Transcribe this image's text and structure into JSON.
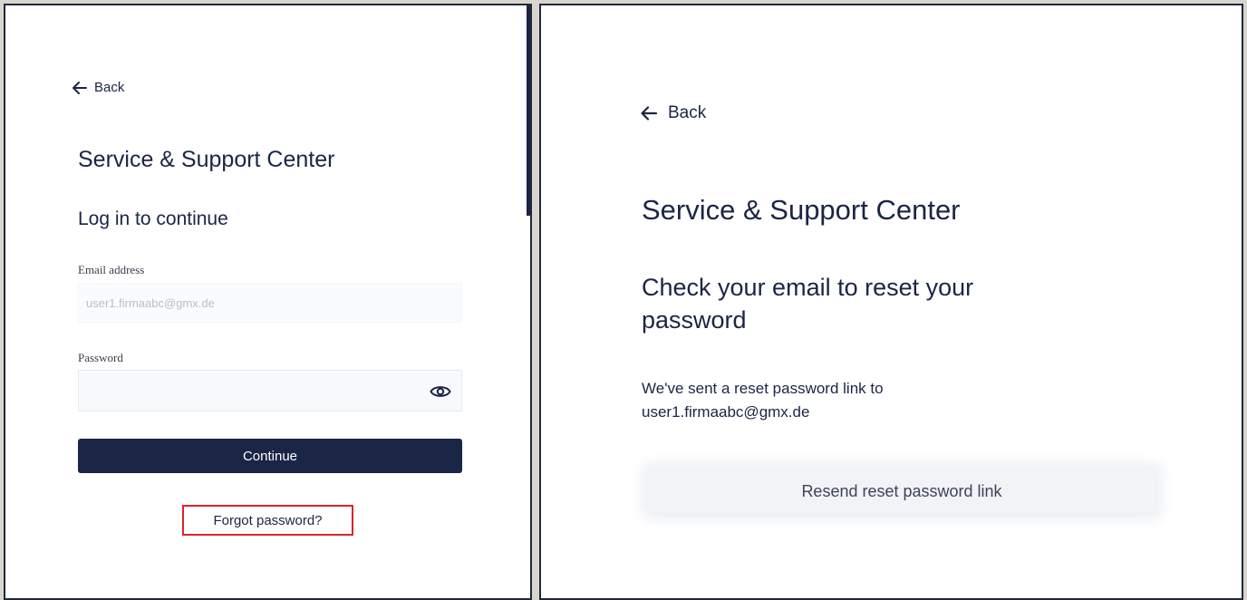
{
  "login_panel": {
    "back_label": "Back",
    "app_title": "Service & Support Center",
    "heading": "Log in to continue",
    "email": {
      "label": "Email address",
      "value": "user1.firmaabc@gmx.de"
    },
    "password": {
      "label": "Password",
      "value": ""
    },
    "continue_label": "Continue",
    "forgot_label": "Forgot password?"
  },
  "reset_panel": {
    "back_label": "Back",
    "app_title": "Service & Support Center",
    "heading": "Check your email to reset your password",
    "message_line1": "We've sent a reset password link to",
    "message_email": "user1.firmaabc@gmx.de",
    "resend_label": "Resend reset password link"
  },
  "colors": {
    "brand_navy": "#1b2545",
    "highlight_red": "#d8262c",
    "frame": "#d9d4ce"
  },
  "icons": {
    "back": "arrow-left-icon",
    "password_toggle": "eye-icon"
  }
}
